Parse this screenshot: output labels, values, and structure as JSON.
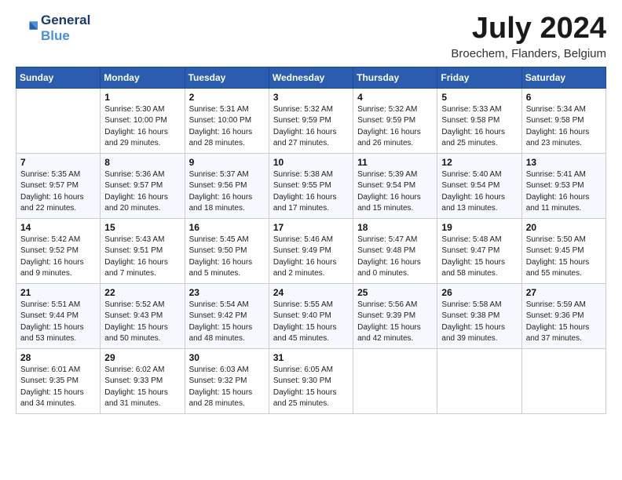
{
  "logo": {
    "line1": "General",
    "line2": "Blue"
  },
  "title": "July 2024",
  "location": "Broechem, Flanders, Belgium",
  "days_of_week": [
    "Sunday",
    "Monday",
    "Tuesday",
    "Wednesday",
    "Thursday",
    "Friday",
    "Saturday"
  ],
  "weeks": [
    [
      {
        "day": "",
        "info": ""
      },
      {
        "day": "1",
        "info": "Sunrise: 5:30 AM\nSunset: 10:00 PM\nDaylight: 16 hours\nand 29 minutes."
      },
      {
        "day": "2",
        "info": "Sunrise: 5:31 AM\nSunset: 10:00 PM\nDaylight: 16 hours\nand 28 minutes."
      },
      {
        "day": "3",
        "info": "Sunrise: 5:32 AM\nSunset: 9:59 PM\nDaylight: 16 hours\nand 27 minutes."
      },
      {
        "day": "4",
        "info": "Sunrise: 5:32 AM\nSunset: 9:59 PM\nDaylight: 16 hours\nand 26 minutes."
      },
      {
        "day": "5",
        "info": "Sunrise: 5:33 AM\nSunset: 9:58 PM\nDaylight: 16 hours\nand 25 minutes."
      },
      {
        "day": "6",
        "info": "Sunrise: 5:34 AM\nSunset: 9:58 PM\nDaylight: 16 hours\nand 23 minutes."
      }
    ],
    [
      {
        "day": "7",
        "info": "Sunrise: 5:35 AM\nSunset: 9:57 PM\nDaylight: 16 hours\nand 22 minutes."
      },
      {
        "day": "8",
        "info": "Sunrise: 5:36 AM\nSunset: 9:57 PM\nDaylight: 16 hours\nand 20 minutes."
      },
      {
        "day": "9",
        "info": "Sunrise: 5:37 AM\nSunset: 9:56 PM\nDaylight: 16 hours\nand 18 minutes."
      },
      {
        "day": "10",
        "info": "Sunrise: 5:38 AM\nSunset: 9:55 PM\nDaylight: 16 hours\nand 17 minutes."
      },
      {
        "day": "11",
        "info": "Sunrise: 5:39 AM\nSunset: 9:54 PM\nDaylight: 16 hours\nand 15 minutes."
      },
      {
        "day": "12",
        "info": "Sunrise: 5:40 AM\nSunset: 9:54 PM\nDaylight: 16 hours\nand 13 minutes."
      },
      {
        "day": "13",
        "info": "Sunrise: 5:41 AM\nSunset: 9:53 PM\nDaylight: 16 hours\nand 11 minutes."
      }
    ],
    [
      {
        "day": "14",
        "info": "Sunrise: 5:42 AM\nSunset: 9:52 PM\nDaylight: 16 hours\nand 9 minutes."
      },
      {
        "day": "15",
        "info": "Sunrise: 5:43 AM\nSunset: 9:51 PM\nDaylight: 16 hours\nand 7 minutes."
      },
      {
        "day": "16",
        "info": "Sunrise: 5:45 AM\nSunset: 9:50 PM\nDaylight: 16 hours\nand 5 minutes."
      },
      {
        "day": "17",
        "info": "Sunrise: 5:46 AM\nSunset: 9:49 PM\nDaylight: 16 hours\nand 2 minutes."
      },
      {
        "day": "18",
        "info": "Sunrise: 5:47 AM\nSunset: 9:48 PM\nDaylight: 16 hours\nand 0 minutes."
      },
      {
        "day": "19",
        "info": "Sunrise: 5:48 AM\nSunset: 9:47 PM\nDaylight: 15 hours\nand 58 minutes."
      },
      {
        "day": "20",
        "info": "Sunrise: 5:50 AM\nSunset: 9:45 PM\nDaylight: 15 hours\nand 55 minutes."
      }
    ],
    [
      {
        "day": "21",
        "info": "Sunrise: 5:51 AM\nSunset: 9:44 PM\nDaylight: 15 hours\nand 53 minutes."
      },
      {
        "day": "22",
        "info": "Sunrise: 5:52 AM\nSunset: 9:43 PM\nDaylight: 15 hours\nand 50 minutes."
      },
      {
        "day": "23",
        "info": "Sunrise: 5:54 AM\nSunset: 9:42 PM\nDaylight: 15 hours\nand 48 minutes."
      },
      {
        "day": "24",
        "info": "Sunrise: 5:55 AM\nSunset: 9:40 PM\nDaylight: 15 hours\nand 45 minutes."
      },
      {
        "day": "25",
        "info": "Sunrise: 5:56 AM\nSunset: 9:39 PM\nDaylight: 15 hours\nand 42 minutes."
      },
      {
        "day": "26",
        "info": "Sunrise: 5:58 AM\nSunset: 9:38 PM\nDaylight: 15 hours\nand 39 minutes."
      },
      {
        "day": "27",
        "info": "Sunrise: 5:59 AM\nSunset: 9:36 PM\nDaylight: 15 hours\nand 37 minutes."
      }
    ],
    [
      {
        "day": "28",
        "info": "Sunrise: 6:01 AM\nSunset: 9:35 PM\nDaylight: 15 hours\nand 34 minutes."
      },
      {
        "day": "29",
        "info": "Sunrise: 6:02 AM\nSunset: 9:33 PM\nDaylight: 15 hours\nand 31 minutes."
      },
      {
        "day": "30",
        "info": "Sunrise: 6:03 AM\nSunset: 9:32 PM\nDaylight: 15 hours\nand 28 minutes."
      },
      {
        "day": "31",
        "info": "Sunrise: 6:05 AM\nSunset: 9:30 PM\nDaylight: 15 hours\nand 25 minutes."
      },
      {
        "day": "",
        "info": ""
      },
      {
        "day": "",
        "info": ""
      },
      {
        "day": "",
        "info": ""
      }
    ]
  ]
}
